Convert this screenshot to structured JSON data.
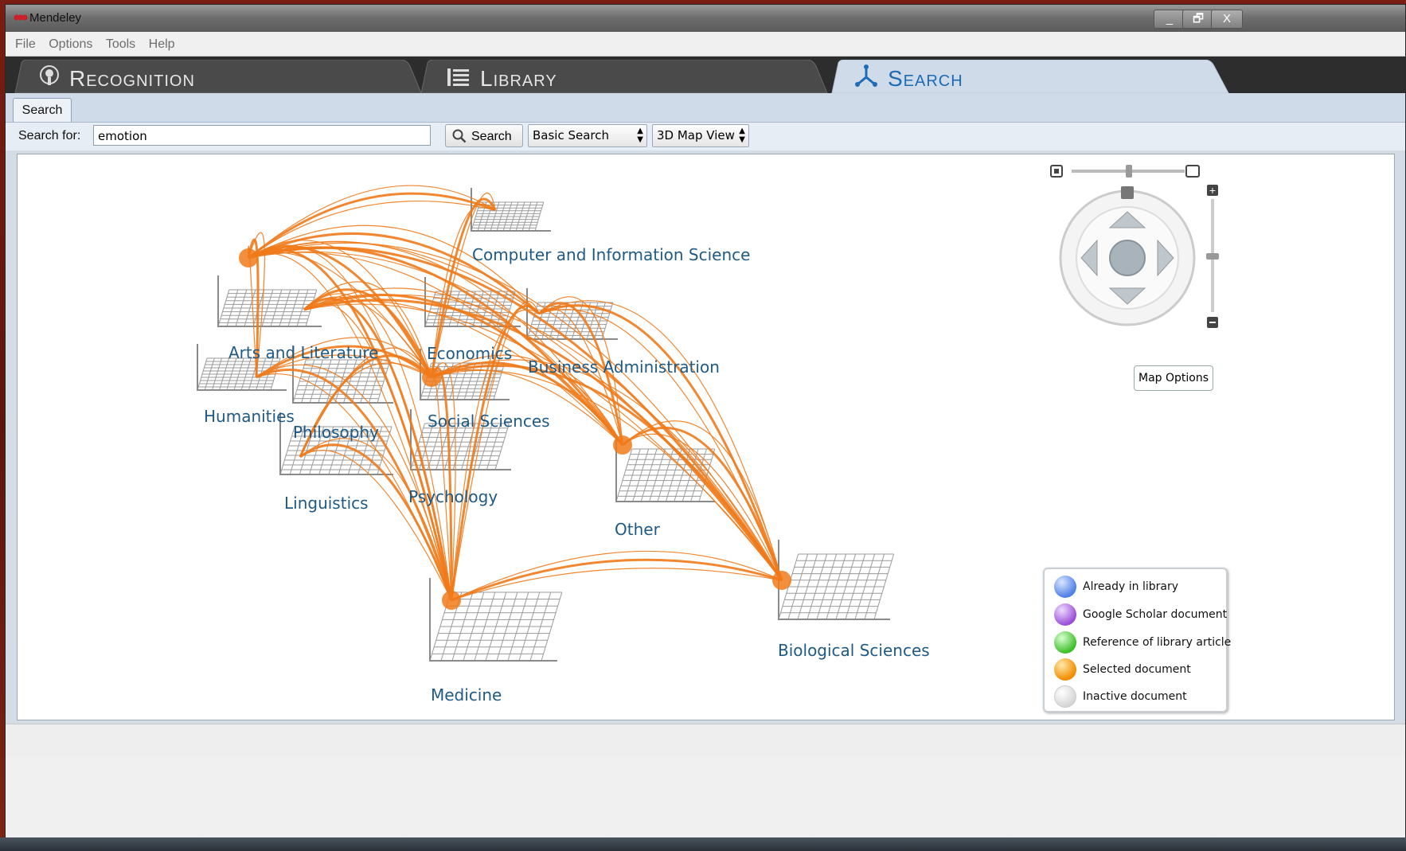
{
  "window": {
    "title": "Mendeley",
    "buttons": [
      "_",
      "🗗",
      "X"
    ]
  },
  "menu": [
    "File",
    "Options",
    "Tools",
    "Help"
  ],
  "tabs": [
    {
      "label": "Recognition",
      "active": false
    },
    {
      "label": "Library",
      "active": false
    },
    {
      "label": "Search",
      "active": true
    }
  ],
  "subtab": "Search",
  "search": {
    "label": "Search for:",
    "value": "emotion",
    "button": "Search",
    "mode": "Basic Search",
    "view": "3D Map View"
  },
  "map": {
    "categories": [
      "Computer and Information Science",
      "Arts and Literature",
      "Economics",
      "Business Administration",
      "Humanities",
      "Philosophy",
      "Social Sciences",
      "Linguistics",
      "Psychology",
      "Other",
      "Biological Sciences",
      "Medicine"
    ],
    "options_button": "Map Options",
    "link_color": "#f07a1a"
  },
  "legend": [
    {
      "label": "Already in library",
      "color": "#4f7fe6"
    },
    {
      "label": "Google Scholar document",
      "color": "#9a4fd8"
    },
    {
      "label": "Reference of library article",
      "color": "#3fbf2a"
    },
    {
      "label": "Selected document",
      "color": "#f08d00"
    },
    {
      "label": "Inactive document",
      "color": "#e8e8e8"
    }
  ]
}
